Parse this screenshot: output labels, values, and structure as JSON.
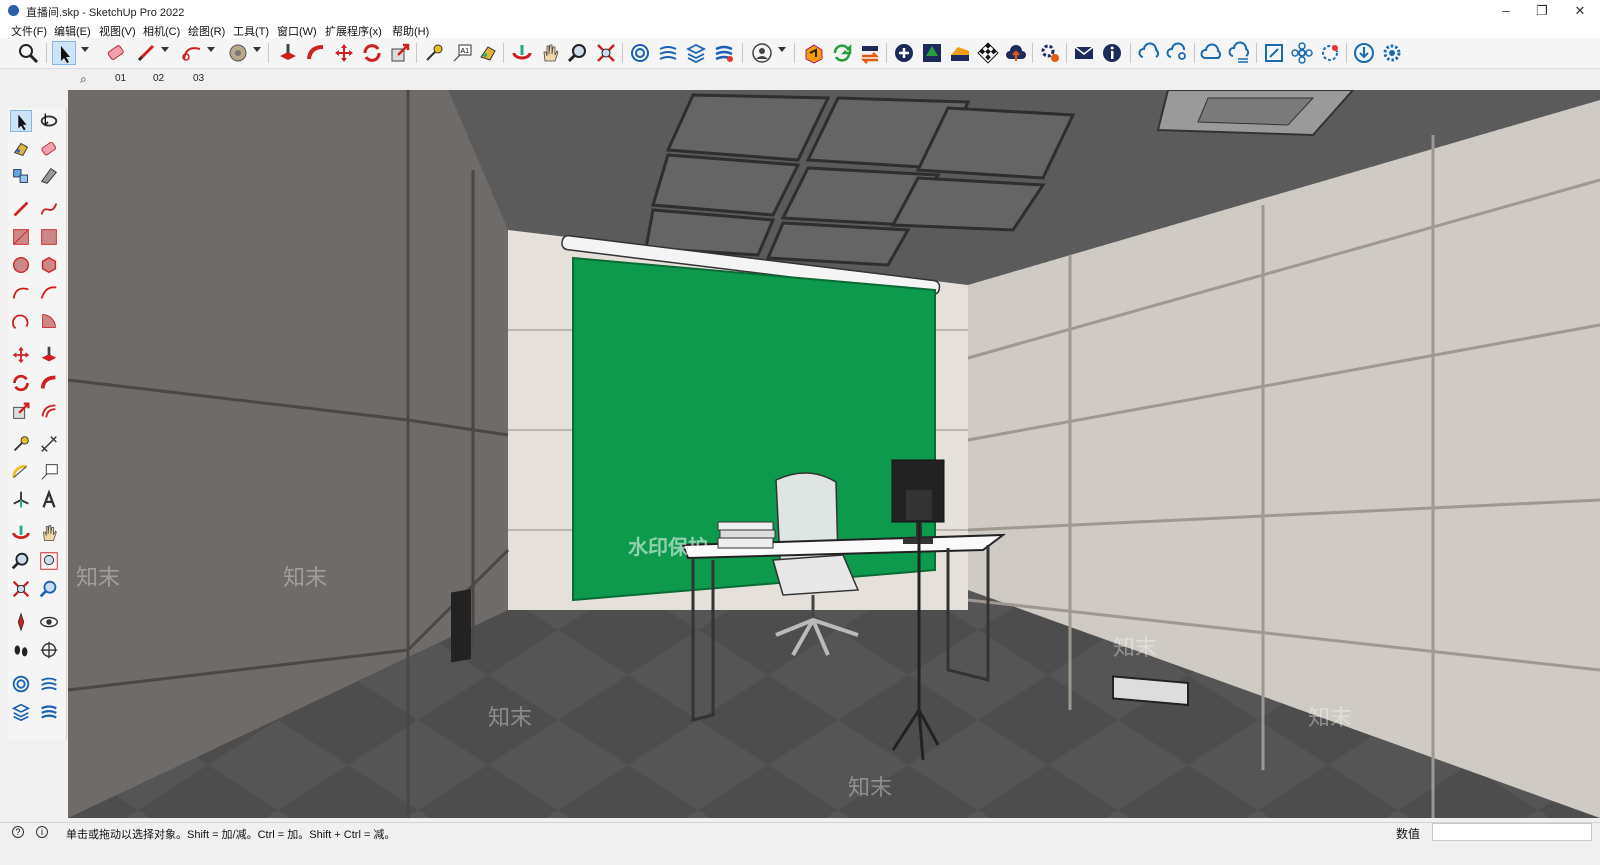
{
  "window": {
    "title": "直播间.skp - SketchUp Pro 2022",
    "minimize": "–",
    "maximize": "❐",
    "close": "✕"
  },
  "menu": [
    "文件(F)",
    "编辑(E)",
    "视图(V)",
    "相机(C)",
    "绘图(R)",
    "工具(T)",
    "窗口(W)",
    "扩展程序(x)",
    "帮助(H)"
  ],
  "scenes": {
    "tabs": [
      "01",
      "02",
      "03"
    ]
  },
  "toolbar": {
    "icons": [
      "zoom-extents-icon",
      "select-icon",
      "eraser-icon",
      "line-icon",
      "arc-icon",
      "paint-bucket-icon",
      "push-pull-icon",
      "follow-me-icon",
      "move-icon",
      "rotate-icon",
      "scale-icon",
      "tape-measure-icon",
      "text-icon",
      "paint-icon",
      "orbit-icon",
      "pan-icon",
      "zoom-icon",
      "zoom-window-icon",
      "component-icon",
      "styles-icon",
      "layers-icon",
      "scenes-icon",
      "account-icon",
      "extension-warehouse-icon",
      "refresh-icon",
      "swap-icon",
      "add-icon",
      "tree-icon",
      "chart-icon",
      "checker-icon",
      "cloud-upload-icon",
      "gear-icon",
      "mail-icon",
      "info-icon",
      "cloud-sync-icon",
      "cloud-search-icon",
      "cloud-icon",
      "cloud-list-icon",
      "frame-icon",
      "flower-icon",
      "settings-badge-icon",
      "download-icon",
      "settings-icon"
    ]
  },
  "status": {
    "hint": "单击或拖动以选择对象。Shift = 加/减。Ctrl = 加。Shift + Ctrl = 减。",
    "measurements_label": "数值"
  },
  "viewport": {
    "watermark_banner": "水印保护",
    "watermark_logo": "知末"
  },
  "colors": {
    "green_screen": "#0d9a4c",
    "ceiling": "#5b5b5b",
    "wall_dark": "#6e6b68",
    "wall_light": "#d6d1cb",
    "floor": "#4e4e4e"
  }
}
